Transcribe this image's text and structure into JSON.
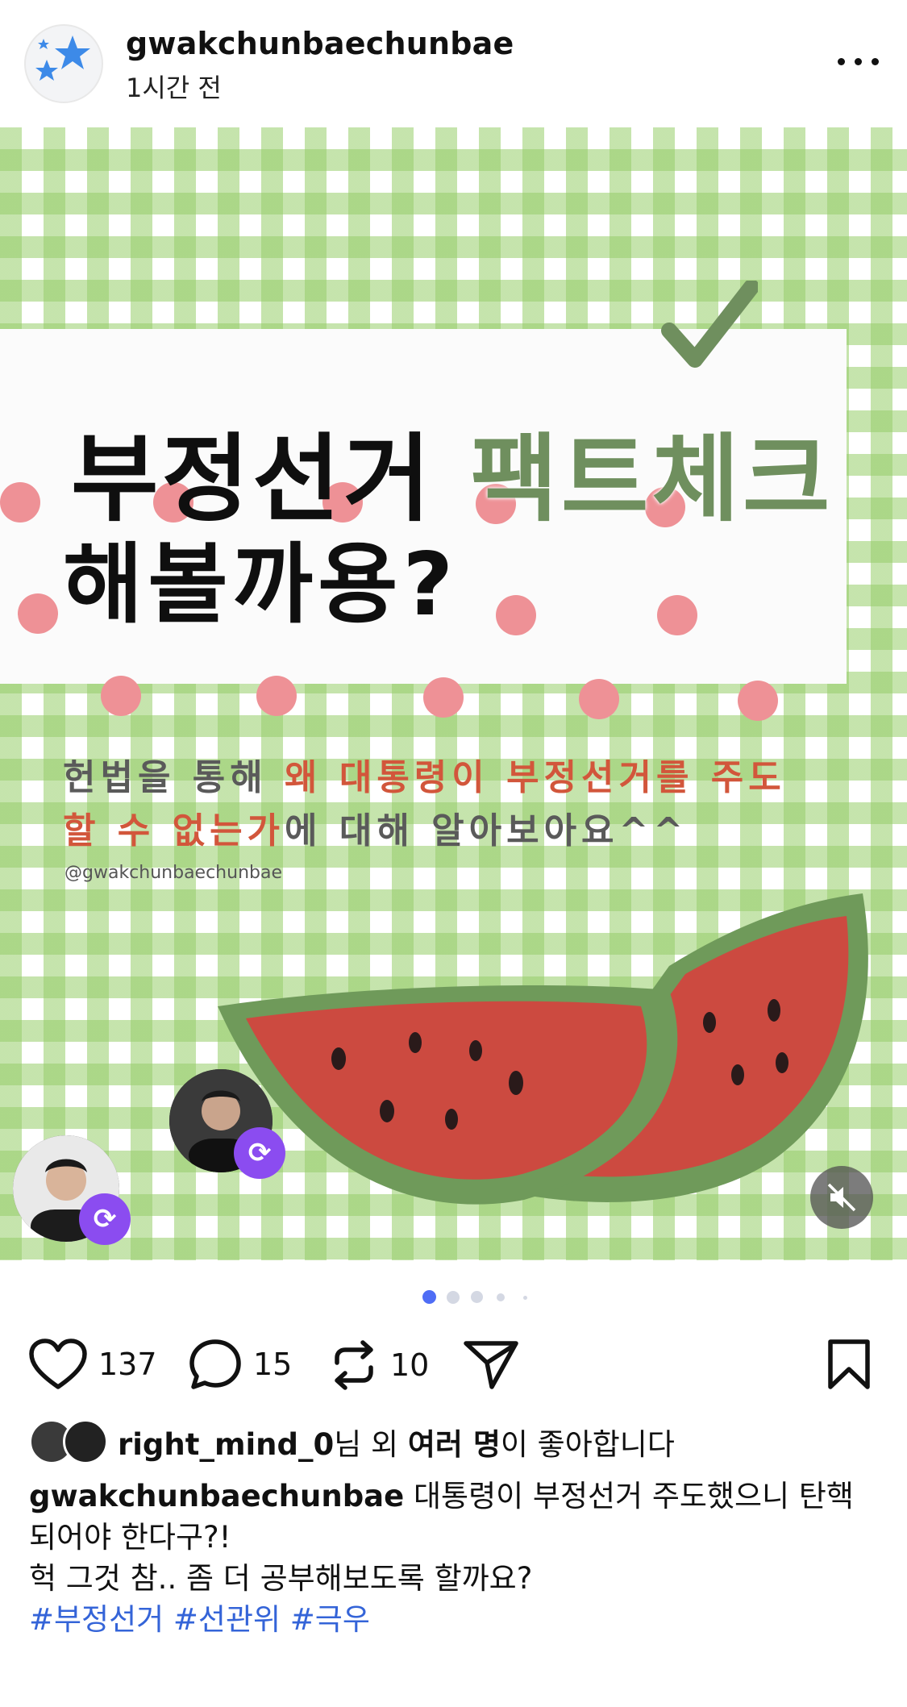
{
  "post": {
    "username": "gwakchunbaechunbae",
    "time_ago": "1시간 전",
    "more_icon": "more-horizontal-icon"
  },
  "image": {
    "headline_part1": "부정선거 ",
    "headline_part2": "팩트체크",
    "headline_line2": "해볼까용?",
    "sub_line1_a": "헌법을 통해 ",
    "sub_line1_b": "왜 대통령이 부정선거를 주도",
    "sub_line2_a": "할 수 없는가",
    "sub_line2_b": "에 대해 알아보아요^^",
    "handle": "@gwakchunbaechunbae",
    "colors": {
      "gingham": "#96cd69",
      "dot": "#ee9196",
      "highlight": "#d2563b",
      "green_text": "#6f8f5e"
    }
  },
  "carousel": {
    "pages": 5,
    "active": 1
  },
  "actions": {
    "likes": "137",
    "comments": "15",
    "reposts": "10"
  },
  "liked_by": {
    "user": "right_mind_0",
    "text_mid": "님 외 ",
    "others": "여러 명",
    "text_end": "이 좋아합니다"
  },
  "caption": {
    "username": "gwakchunbaechunbae",
    "line1": " 대통령이 부정선거 주도했으니 탄핵",
    "line2": "되어야 한다구?!",
    "line3": "헉 그것 참.. 좀 더 공부해보도록 할까요?",
    "hashtags": "#부정선거 #선관위 #극우"
  }
}
